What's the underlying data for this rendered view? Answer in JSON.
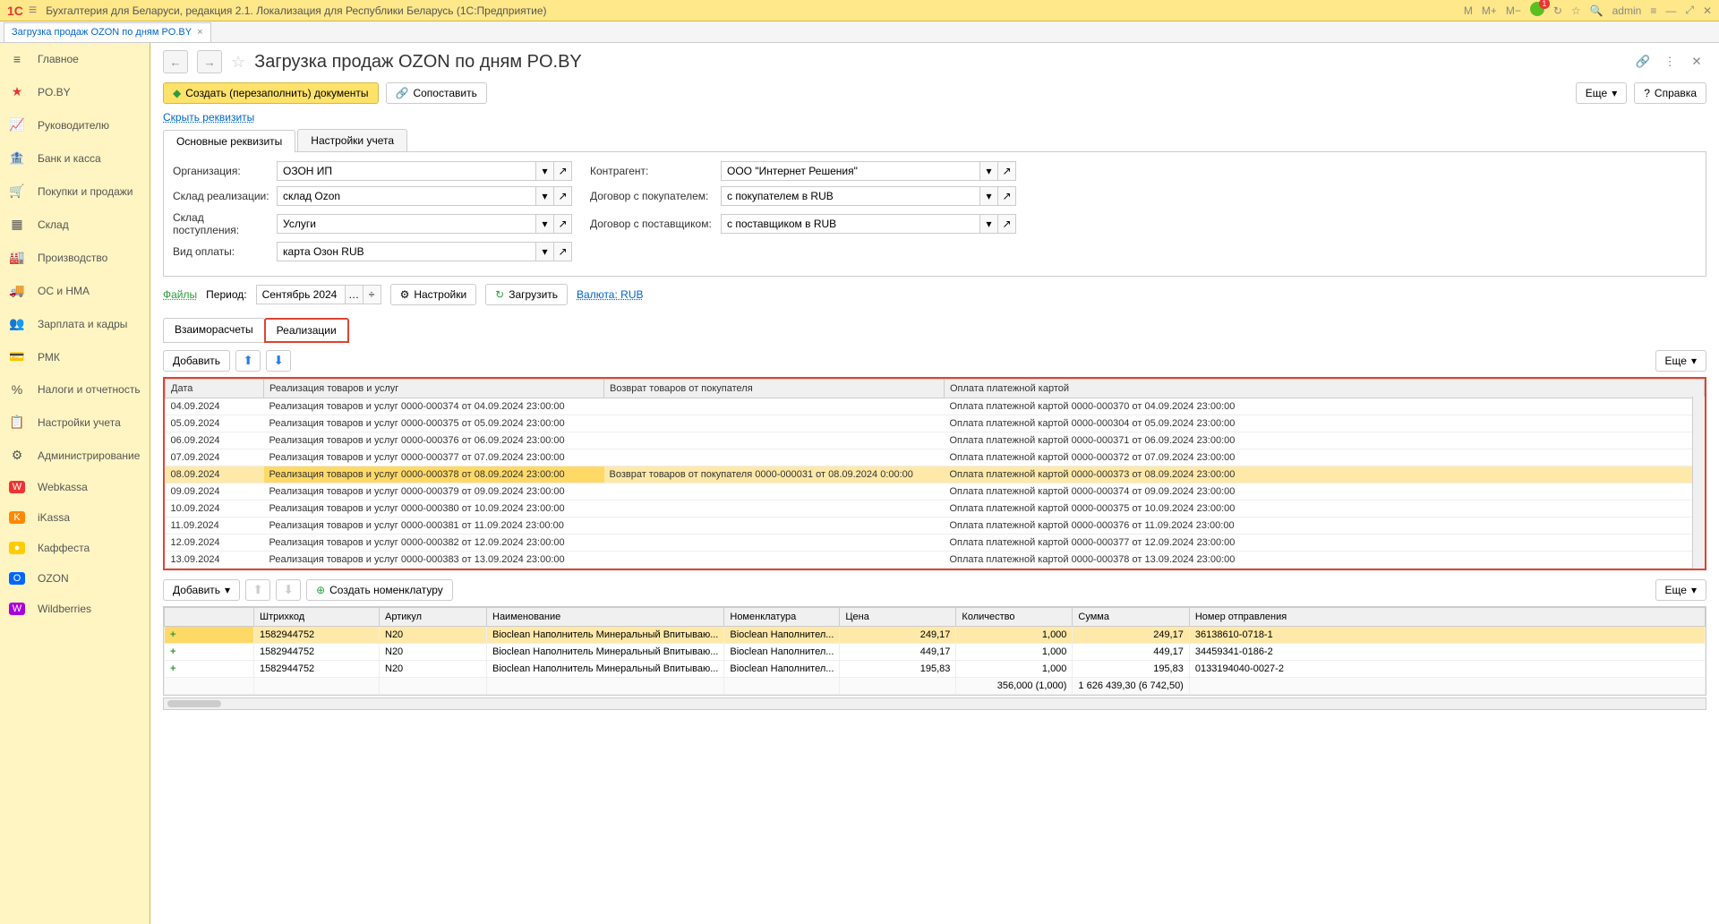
{
  "app_title": "Бухгалтерия для Беларуси, редакция 2.1. Локализация для Республики Беларусь  (1С:Предприятие)",
  "top_right": {
    "m": "M",
    "m_plus": "M+",
    "m_minus": "M−",
    "notif_count": "1",
    "user": "admin"
  },
  "tab": {
    "label": "Загрузка продаж OZON по дням PO.BY",
    "close": "×"
  },
  "sidebar": {
    "items": [
      {
        "icon": "≡",
        "label": "Главное"
      },
      {
        "icon": "★",
        "label": "PO.BY",
        "color": "#e33"
      },
      {
        "icon": "📈",
        "label": "Руководителю"
      },
      {
        "icon": "🏦",
        "label": "Банк и касса"
      },
      {
        "icon": "🛒",
        "label": "Покупки и продажи"
      },
      {
        "icon": "▦",
        "label": "Склад"
      },
      {
        "icon": "🏭",
        "label": "Производство"
      },
      {
        "icon": "🚚",
        "label": "ОС и НМА"
      },
      {
        "icon": "👥",
        "label": "Зарплата и кадры"
      },
      {
        "icon": "💳",
        "label": "РМК"
      },
      {
        "icon": "%",
        "label": "Налоги и отчетность"
      },
      {
        "icon": "📋",
        "label": "Настройки учета"
      },
      {
        "icon": "⚙",
        "label": "Администрирование"
      },
      {
        "icon": "W",
        "label": "Webkassa",
        "iconbg": "#e33"
      },
      {
        "icon": "K",
        "label": "iKassa",
        "iconbg": "#f80"
      },
      {
        "icon": "●",
        "label": "Каффеста",
        "iconbg": "#fc0"
      },
      {
        "icon": "O",
        "label": "OZON",
        "iconbg": "#06f"
      },
      {
        "icon": "W",
        "label": "Wildberries",
        "iconbg": "#a0d"
      }
    ]
  },
  "page_title": "Загрузка продаж OZON по дням PO.BY",
  "actions": {
    "create": "Создать (перезаполнить) документы",
    "compare": "Сопоставить",
    "more": "Еще",
    "help": "Справка",
    "hide": "Скрыть реквизиты"
  },
  "form_tabs": {
    "main": "Основные реквизиты",
    "settings": "Настройки учета"
  },
  "form": {
    "org_label": "Организация:",
    "org": "ОЗОН ИП",
    "warehouse_sale_label": "Склад реализации:",
    "warehouse_sale": "склад Ozon",
    "warehouse_in_label": "Склад поступления:",
    "warehouse_in": "Услуги",
    "payment_label": "Вид оплаты:",
    "payment": "карта Озон RUB",
    "contragent_label": "Контрагент:",
    "contragent": "ООО \"Интернет Решения\"",
    "contract_buyer_label": "Договор с покупателем:",
    "contract_buyer": "с покупателем в RUB",
    "contract_supplier_label": "Договор с поставщиком:",
    "contract_supplier": "с поставщиком в RUB"
  },
  "period_bar": {
    "files": "Файлы",
    "period_label": "Период:",
    "period": "Сентябрь 2024 г.",
    "settings": "Настройки",
    "load": "Загрузить",
    "currency": "Валюта: RUB"
  },
  "data_tabs": {
    "settlements": "Взаиморасчеты",
    "realizations": "Реализации"
  },
  "table_toolbar": {
    "add": "Добавить",
    "more": "Еще"
  },
  "main_table": {
    "headers": {
      "date": "Дата",
      "real": "Реализация товаров и услуг",
      "return": "Возврат товаров от покупателя",
      "pay": "Оплата платежной картой"
    },
    "rows": [
      {
        "date": "04.09.2024",
        "real": "Реализация товаров и услуг 0000-000374 от 04.09.2024 23:00:00",
        "return": "",
        "pay": "Оплата платежной картой 0000-000370 от 04.09.2024 23:00:00"
      },
      {
        "date": "05.09.2024",
        "real": "Реализация товаров и услуг 0000-000375 от 05.09.2024 23:00:00",
        "return": "",
        "pay": "Оплата платежной картой 0000-000304 от 05.09.2024 23:00:00"
      },
      {
        "date": "06.09.2024",
        "real": "Реализация товаров и услуг 0000-000376 от 06.09.2024 23:00:00",
        "return": "",
        "pay": "Оплата платежной картой 0000-000371 от 06.09.2024 23:00:00"
      },
      {
        "date": "07.09.2024",
        "real": "Реализация товаров и услуг 0000-000377 от 07.09.2024 23:00:00",
        "return": "",
        "pay": "Оплата платежной картой 0000-000372 от 07.09.2024 23:00:00"
      },
      {
        "date": "08.09.2024",
        "real": "Реализация товаров и услуг 0000-000378 от 08.09.2024 23:00:00",
        "return": "Возврат товаров от покупателя 0000-000031 от 08.09.2024 0:00:00",
        "pay": "Оплата платежной картой 0000-000373 от 08.09.2024 23:00:00",
        "hl": true
      },
      {
        "date": "09.09.2024",
        "real": "Реализация товаров и услуг 0000-000379 от 09.09.2024 23:00:00",
        "return": "",
        "pay": "Оплата платежной картой 0000-000374 от 09.09.2024 23:00:00"
      },
      {
        "date": "10.09.2024",
        "real": "Реализация товаров и услуг 0000-000380 от 10.09.2024 23:00:00",
        "return": "",
        "pay": "Оплата платежной картой 0000-000375 от 10.09.2024 23:00:00"
      },
      {
        "date": "11.09.2024",
        "real": "Реализация товаров и услуг 0000-000381 от 11.09.2024 23:00:00",
        "return": "",
        "pay": "Оплата платежной картой 0000-000376 от 11.09.2024 23:00:00"
      },
      {
        "date": "12.09.2024",
        "real": "Реализация товаров и услуг 0000-000382 от 12.09.2024 23:00:00",
        "return": "",
        "pay": "Оплата платежной картой 0000-000377 от 12.09.2024 23:00:00"
      },
      {
        "date": "13.09.2024",
        "real": "Реализация товаров и услуг 0000-000383 от 13.09.2024 23:00:00",
        "return": "",
        "pay": "Оплата платежной картой 0000-000378 от 13.09.2024 23:00:00"
      }
    ]
  },
  "detail_toolbar": {
    "add": "Добавить",
    "nomenclature": "Создать номенклатуру",
    "more": "Еще"
  },
  "detail_table": {
    "headers": {
      "empty": "",
      "barcode": "Штрихкод",
      "article": "Артикул",
      "name": "Наименование",
      "nomenclature": "Номенклатура",
      "price": "Цена",
      "qty": "Количество",
      "sum": "Сумма",
      "shipment": "Номер отправления"
    },
    "rows": [
      {
        "barcode": "1582944752",
        "article": "N20",
        "name": "Bioclean Наполнитель Минеральный Впитываю...",
        "nom": "Bioclean Наполнител...",
        "price": "249,17",
        "qty": "1,000",
        "sum": "249,17",
        "ship": "36138610-0718-1",
        "hl": true
      },
      {
        "barcode": "1582944752",
        "article": "N20",
        "name": "Bioclean Наполнитель Минеральный Впитываю...",
        "nom": "Bioclean Наполнител...",
        "price": "449,17",
        "qty": "1,000",
        "sum": "449,17",
        "ship": "34459341-0186-2"
      },
      {
        "barcode": "1582944752",
        "article": "N20",
        "name": "Bioclean Наполнитель Минеральный Впитываю...",
        "nom": "Bioclean Наполнител...",
        "price": "195,83",
        "qty": "1,000",
        "sum": "195,83",
        "ship": "0133194040-0027-2"
      }
    ],
    "totals": {
      "qty": "356,000 (1,000)",
      "sum": "1 626 439,30 (6 742,50)"
    }
  }
}
